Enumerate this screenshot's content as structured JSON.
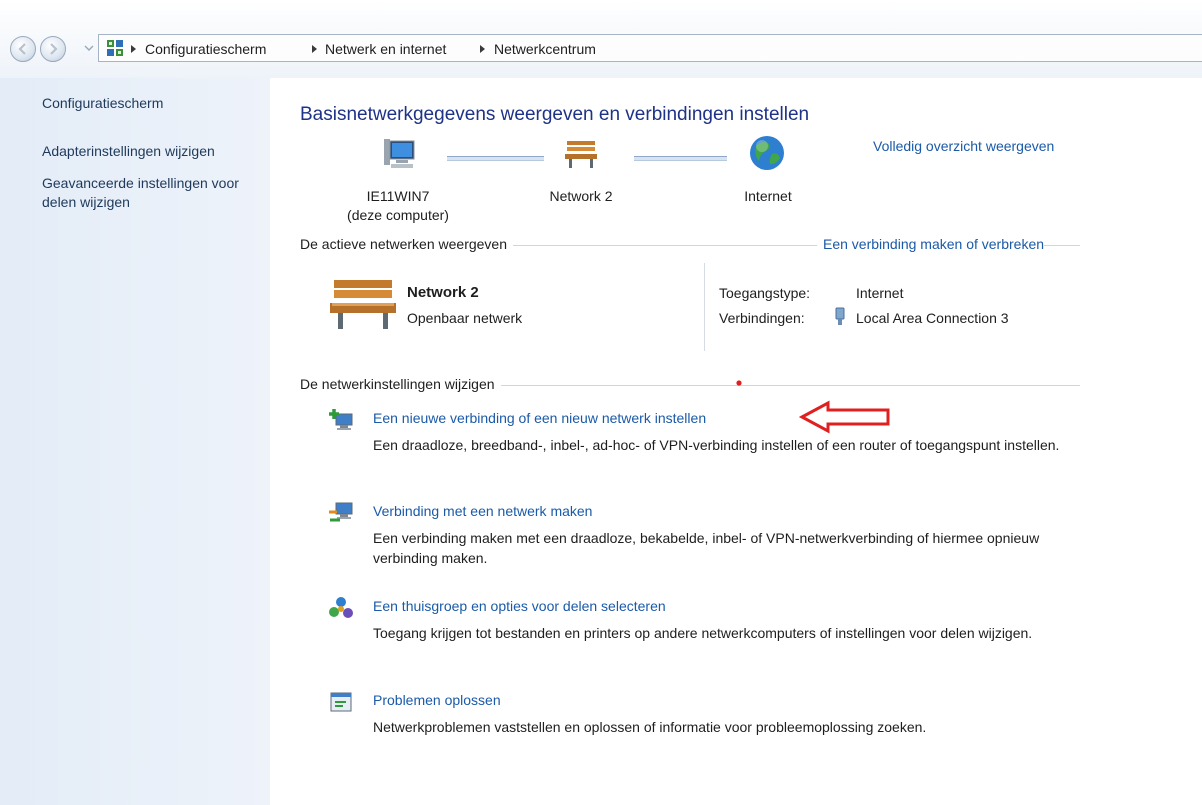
{
  "breadcrumb": {
    "items": [
      "Configuratiescherm",
      "Netwerk en internet",
      "Netwerkcentrum"
    ]
  },
  "sidebar": {
    "items": [
      {
        "label": "Configuratiescherm"
      },
      {
        "label": "Adapterinstellingen wijzigen"
      },
      {
        "label": "Geavanceerde instellingen voor delen wijzigen"
      }
    ]
  },
  "main": {
    "title": "Basisnetwerkgegevens weergeven en verbindingen instellen",
    "full_map_link": "Volledig overzicht weergeven",
    "map": {
      "computer_name": "IE11WIN7",
      "computer_sub": "(deze computer)",
      "network": "Network  2",
      "internet": "Internet"
    },
    "active_section": {
      "header": "De actieve netwerken weergeven",
      "link": "Een verbinding maken of verbreken",
      "network_name": "Network  2",
      "network_type": "Openbaar netwerk",
      "access_type_label": "Toegangstype:",
      "access_type_value": "Internet",
      "connections_label": "Verbindingen:",
      "connections_value": "Local Area Connection 3"
    },
    "settings_section": {
      "header": "De netwerkinstellingen wijzigen",
      "tasks": [
        {
          "link": "Een nieuwe verbinding of een nieuw netwerk instellen",
          "desc": "Een draadloze, breedband-, inbel-, ad-hoc- of VPN-verbinding instellen of een router of toegangspunt instellen.",
          "icon": "new-connection-icon"
        },
        {
          "link": "Verbinding met een netwerk maken",
          "desc": "Een verbinding maken met een draadloze, bekabelde, inbel- of VPN-netwerkverbinding of hiermee opnieuw verbinding maken.",
          "icon": "connect-network-icon"
        },
        {
          "link": "Een thuisgroep en opties voor delen selecteren",
          "desc": "Toegang krijgen tot bestanden en printers op andere netwerkcomputers of instellingen voor delen wijzigen.",
          "icon": "homegroup-icon"
        },
        {
          "link": "Problemen oplossen",
          "desc": "Netwerkproblemen vaststellen en oplossen of informatie voor probleemoplossing zoeken.",
          "icon": "troubleshoot-icon"
        }
      ]
    }
  },
  "colors": {
    "link": "#1a5aa8",
    "title": "#1e3287",
    "annotation_arrow": "#e02020"
  }
}
